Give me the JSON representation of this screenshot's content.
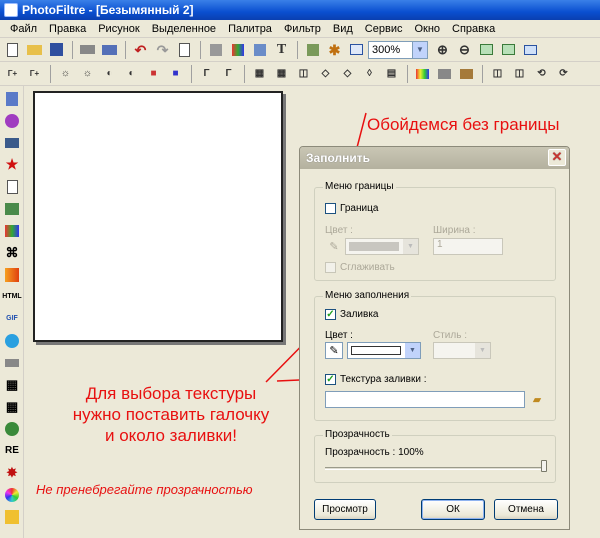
{
  "window": {
    "title": "PhotoFiltre - [Безымянный 2]"
  },
  "menu": [
    "Файл",
    "Правка",
    "Рисунок",
    "Выделенное",
    "Палитра",
    "Фильтр",
    "Вид",
    "Сервис",
    "Окно",
    "Справка"
  ],
  "toolbar": {
    "zoom_value": "300%"
  },
  "canvas": {},
  "annotations": {
    "no_border": "Обойдемся без границы",
    "texture_hint_1": "Для выбора текстуры",
    "texture_hint_2": "нужно поставить галочку",
    "texture_hint_3": "и около заливки!",
    "transparency_hint": "Не пренебрегайте прозрачностью",
    "accent_color": "#e81010"
  },
  "dialog": {
    "title": "Заполнить",
    "border_group": {
      "label": "Меню границы",
      "border_checkbox": "Граница",
      "border_checked": false,
      "color_label": "Цвет :",
      "width_label": "Ширина :",
      "width_value": "1",
      "smooth_checkbox": "Сглаживать"
    },
    "fill_group": {
      "label": "Меню заполнения",
      "fill_checkbox": "Заливка",
      "fill_checked": true,
      "color_label": "Цвет :",
      "style_label": "Стиль :",
      "texture_checkbox": "Текстура заливки :",
      "texture_checked": true,
      "texture_path": ""
    },
    "transparency_group": {
      "label": "Прозрачность",
      "transparency_label": "Прозрачность : 100%",
      "value_percent": 100
    },
    "buttons": {
      "preview": "Просмотр",
      "ok": "ОК",
      "cancel": "Отмена"
    }
  }
}
